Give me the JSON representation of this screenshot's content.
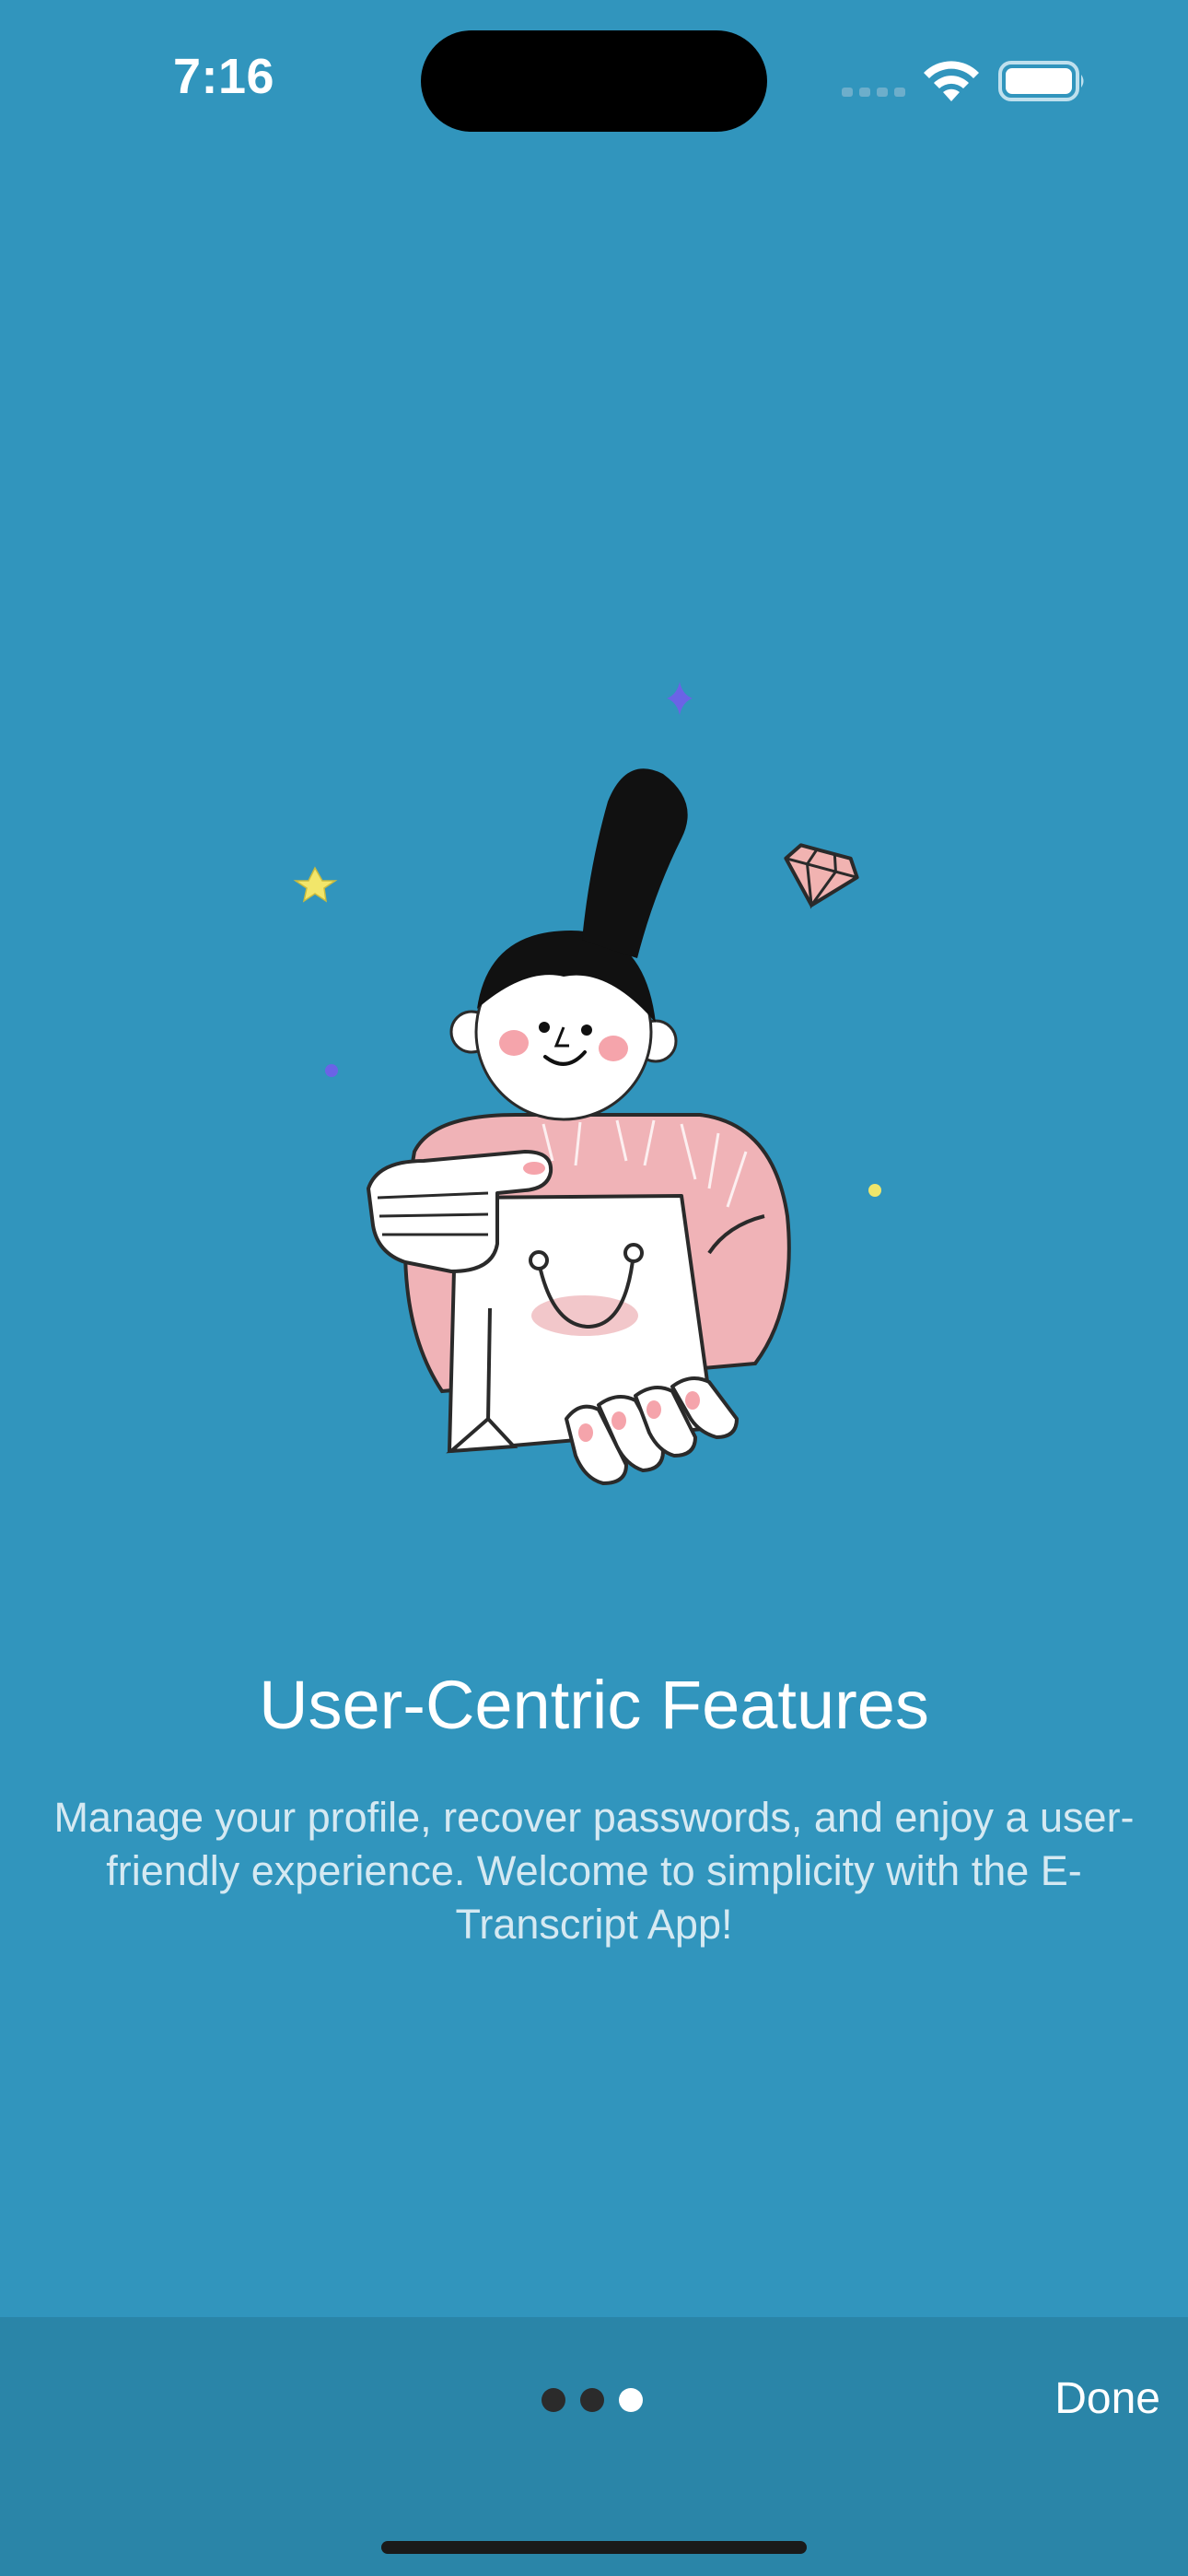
{
  "status_bar": {
    "time": "7:16"
  },
  "onboarding": {
    "title": "User-Centric Features",
    "description": "Manage your profile, recover passwords, and enjoy a user-friendly experience. Welcome to simplicity with the E-Transcript App!",
    "page_count": 3,
    "current_page": 3
  },
  "footer": {
    "done_label": "Done"
  },
  "colors": {
    "background": "#3195BD",
    "bottom_bar": "#2A85A8",
    "accent_pink": "#F0B3B7"
  },
  "icons": {
    "signal": "cellular-signal-icon",
    "wifi": "wifi-icon",
    "battery": "battery-icon"
  }
}
